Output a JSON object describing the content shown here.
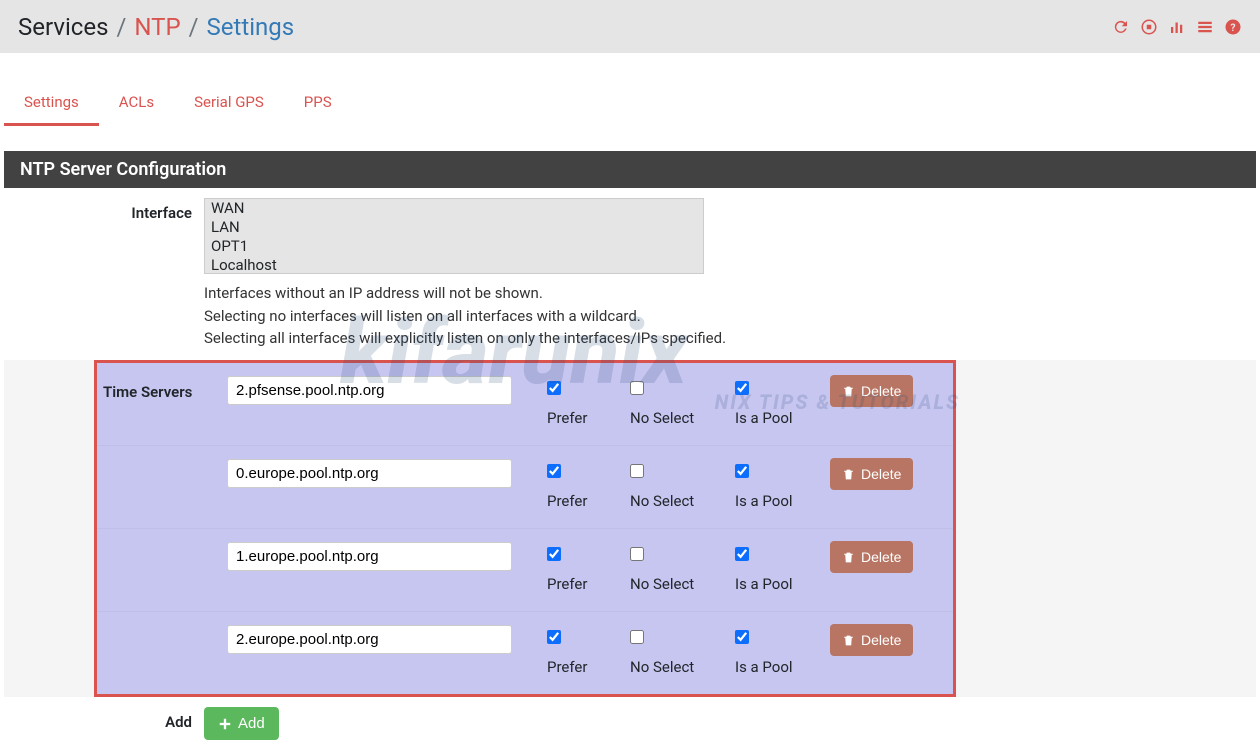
{
  "breadcrumb": {
    "root": "Services",
    "mid": "NTP",
    "leaf": "Settings",
    "sep": "/"
  },
  "tabs": [
    {
      "label": "Settings",
      "active": true
    },
    {
      "label": "ACLs",
      "active": false
    },
    {
      "label": "Serial GPS",
      "active": false
    },
    {
      "label": "PPS",
      "active": false
    }
  ],
  "panel": {
    "title": "NTP Server Configuration"
  },
  "interface": {
    "label": "Interface",
    "options": [
      "WAN",
      "LAN",
      "OPT1",
      "Localhost"
    ],
    "help1": "Interfaces without an IP address will not be shown.",
    "help2": "Selecting no interfaces will listen on all interfaces with a wildcard.",
    "help3": "Selecting all interfaces will explicitly listen on only the interfaces/IPs specified."
  },
  "time_servers": {
    "label": "Time Servers",
    "prefer_label": "Prefer",
    "noselect_label": "No Select",
    "pool_label": "Is a Pool",
    "delete_label": "Delete",
    "rows": [
      {
        "host": "2.pfsense.pool.ntp.org",
        "prefer": true,
        "noselect": false,
        "pool": true
      },
      {
        "host": "0.europe.pool.ntp.org",
        "prefer": true,
        "noselect": false,
        "pool": true
      },
      {
        "host": "1.europe.pool.ntp.org",
        "prefer": true,
        "noselect": false,
        "pool": true
      },
      {
        "host": "2.europe.pool.ntp.org",
        "prefer": true,
        "noselect": false,
        "pool": true
      }
    ]
  },
  "add": {
    "label": "Add",
    "button": "Add"
  },
  "icons": {
    "refresh": "refresh-icon",
    "stop": "stop-icon",
    "chart": "chart-icon",
    "log": "log-icon",
    "help": "help-icon"
  }
}
